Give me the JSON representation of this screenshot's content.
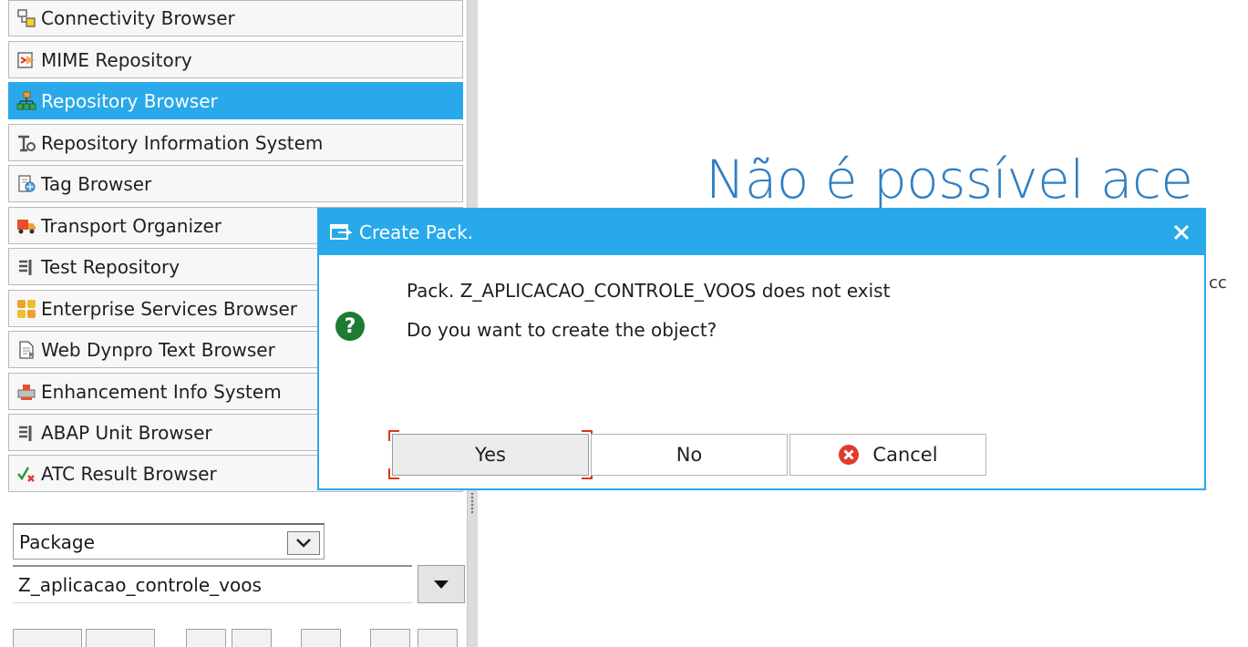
{
  "nav": {
    "items": [
      {
        "label": "Connectivity Browser",
        "icon": "connectivity-icon",
        "selected": false
      },
      {
        "label": "MIME Repository",
        "icon": "mime-icon",
        "selected": false
      },
      {
        "label": "Repository Browser",
        "icon": "hierarchy-icon",
        "selected": true
      },
      {
        "label": "Repository Information System",
        "icon": "info-system-icon",
        "selected": false
      },
      {
        "label": "Tag Browser",
        "icon": "tag-icon",
        "selected": false
      },
      {
        "label": "Transport Organizer",
        "icon": "truck-icon",
        "selected": false
      },
      {
        "label": "Test Repository",
        "icon": "test-icon",
        "selected": false
      },
      {
        "label": "Enterprise Services Browser",
        "icon": "services-icon",
        "selected": false
      },
      {
        "label": "Web Dynpro Text Browser",
        "icon": "document-icon",
        "selected": false
      },
      {
        "label": "Enhancement Info System",
        "icon": "enhancement-icon",
        "selected": false
      },
      {
        "label": "ABAP Unit Browser",
        "icon": "unit-icon",
        "selected": false
      },
      {
        "label": "ATC Result Browser",
        "icon": "check-cross-icon",
        "selected": false
      }
    ],
    "object_type": "Package",
    "object_name": "Z_aplicacao_controle_voos"
  },
  "background": {
    "heading": "Não é possível ace",
    "fragment": "cc"
  },
  "dialog": {
    "title": "Create Pack.",
    "message_line1": "Pack. Z_APLICACAO_CONTROLE_VOOS does not exist",
    "message_line2": "Do you want to create the object?",
    "buttons": {
      "yes": "Yes",
      "no": "No",
      "cancel": "Cancel"
    },
    "focused_button": "yes"
  },
  "colors": {
    "accent": "#29a9ea",
    "question": "#1e7b32",
    "cancel": "#e03b2e",
    "focus": "#d9381e",
    "heading": "#2f7fc4"
  }
}
